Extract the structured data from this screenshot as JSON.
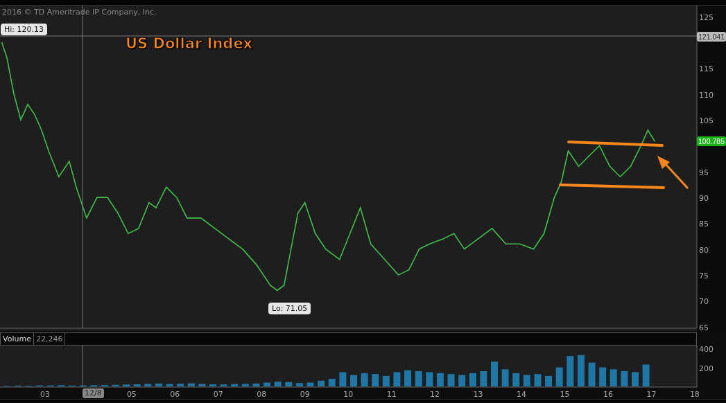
{
  "copyright": "2016 © TD Ameritrade IP Company, Inc.",
  "hi_label": "Hi: 120.13",
  "lo_label": "Lo: 71.05",
  "crosshair_price_tag": "121.041",
  "last_price_tag": "100.785",
  "price_chart": {
    "chart_data": {
      "type": "line",
      "xlim": [
        2001.96,
        2018.05
      ],
      "ylim": [
        64.7,
        127.1
      ],
      "yticks": [
        65,
        70,
        75,
        80,
        85,
        90,
        95,
        105,
        110,
        115,
        125
      ],
      "x": [
        2002.0,
        2002.12,
        2002.28,
        2002.44,
        2002.6,
        2002.76,
        2002.92,
        2003.08,
        2003.32,
        2003.56,
        2003.72,
        2003.96,
        2004.2,
        2004.44,
        2004.68,
        2004.92,
        2005.16,
        2005.4,
        2005.56,
        2005.8,
        2006.04,
        2006.28,
        2006.6,
        2006.92,
        2007.24,
        2007.56,
        2007.88,
        2008.2,
        2008.36,
        2008.52,
        2008.68,
        2008.84,
        2009.0,
        2009.24,
        2009.48,
        2009.8,
        2010.04,
        2010.28,
        2010.52,
        2010.84,
        2011.16,
        2011.4,
        2011.64,
        2011.88,
        2012.2,
        2012.44,
        2012.68,
        2013.0,
        2013.32,
        2013.64,
        2013.96,
        2014.28,
        2014.52,
        2014.76,
        2014.92,
        2015.08,
        2015.32,
        2015.56,
        2015.8,
        2016.04,
        2016.28,
        2016.52,
        2016.76,
        2016.92,
        2017.08
      ],
      "series": [
        {
          "name": "US Dollar Index",
          "color": "#3fbf4a",
          "values": [
            120,
            117,
            110,
            105,
            108,
            106,
            103,
            99,
            94,
            97,
            92,
            86,
            90,
            90,
            87,
            83,
            84,
            89,
            88,
            92,
            90,
            86,
            86,
            84,
            82,
            80,
            77,
            73,
            72,
            73,
            80,
            87,
            89,
            83,
            80,
            78,
            83,
            88,
            81,
            78,
            75,
            76,
            80,
            81,
            82,
            83,
            80,
            82,
            84,
            81,
            81,
            80,
            83,
            90,
            93,
            99,
            96,
            98,
            100,
            96,
            94,
            96,
            100,
            103,
            100.8
          ]
        }
      ]
    }
  },
  "volume_value": "22,246",
  "cursor_date": "12/8",
  "volume_chart": {
    "chart_data": {
      "type": "bar",
      "xlim": [
        2001.96,
        2018.05
      ],
      "ylim": [
        0,
        430
      ],
      "yticks": [
        200,
        400
      ],
      "xticks": [
        {
          "value": 2003,
          "label": "03"
        },
        {
          "value": 2005,
          "label": "05"
        },
        {
          "value": 2006,
          "label": "06"
        },
        {
          "value": 2007,
          "label": "07"
        },
        {
          "value": 2008,
          "label": "08"
        },
        {
          "value": 2009,
          "label": "09"
        },
        {
          "value": 2010,
          "label": "10"
        },
        {
          "value": 2011,
          "label": "11"
        },
        {
          "value": 2012,
          "label": "12"
        },
        {
          "value": 2013,
          "label": "13"
        },
        {
          "value": 2014,
          "label": "14"
        },
        {
          "value": 2015,
          "label": "15"
        },
        {
          "value": 2016,
          "label": "16"
        },
        {
          "value": 2017,
          "label": "17"
        },
        {
          "value": 2018,
          "label": "18"
        }
      ],
      "x": [
        2002.125,
        2002.375,
        2002.625,
        2002.875,
        2003.125,
        2003.375,
        2003.625,
        2003.875,
        2004.125,
        2004.375,
        2004.625,
        2004.875,
        2005.125,
        2005.375,
        2005.625,
        2005.875,
        2006.125,
        2006.375,
        2006.625,
        2006.875,
        2007.125,
        2007.375,
        2007.625,
        2007.875,
        2008.125,
        2008.375,
        2008.625,
        2008.875,
        2009.125,
        2009.375,
        2009.625,
        2009.875,
        2010.125,
        2010.375,
        2010.625,
        2010.875,
        2011.125,
        2011.375,
        2011.625,
        2011.875,
        2012.125,
        2012.375,
        2012.625,
        2012.875,
        2013.125,
        2013.375,
        2013.625,
        2013.875,
        2014.125,
        2014.375,
        2014.625,
        2014.875,
        2015.125,
        2015.375,
        2015.625,
        2015.875,
        2016.125,
        2016.375,
        2016.625,
        2016.875
      ],
      "series": [
        {
          "name": "Volume",
          "color": "#1f77a8",
          "values": [
            5,
            8,
            6,
            10,
            10,
            12,
            8,
            10,
            12,
            14,
            16,
            20,
            22,
            26,
            30,
            24,
            28,
            32,
            26,
            22,
            20,
            24,
            26,
            30,
            40,
            50,
            45,
            35,
            40,
            60,
            80,
            150,
            120,
            140,
            130,
            110,
            150,
            170,
            160,
            150,
            140,
            130,
            120,
            140,
            160,
            260,
            180,
            140,
            120,
            130,
            110,
            200,
            320,
            330,
            250,
            200,
            180,
            160,
            150,
            230
          ]
        }
      ]
    }
  }
}
